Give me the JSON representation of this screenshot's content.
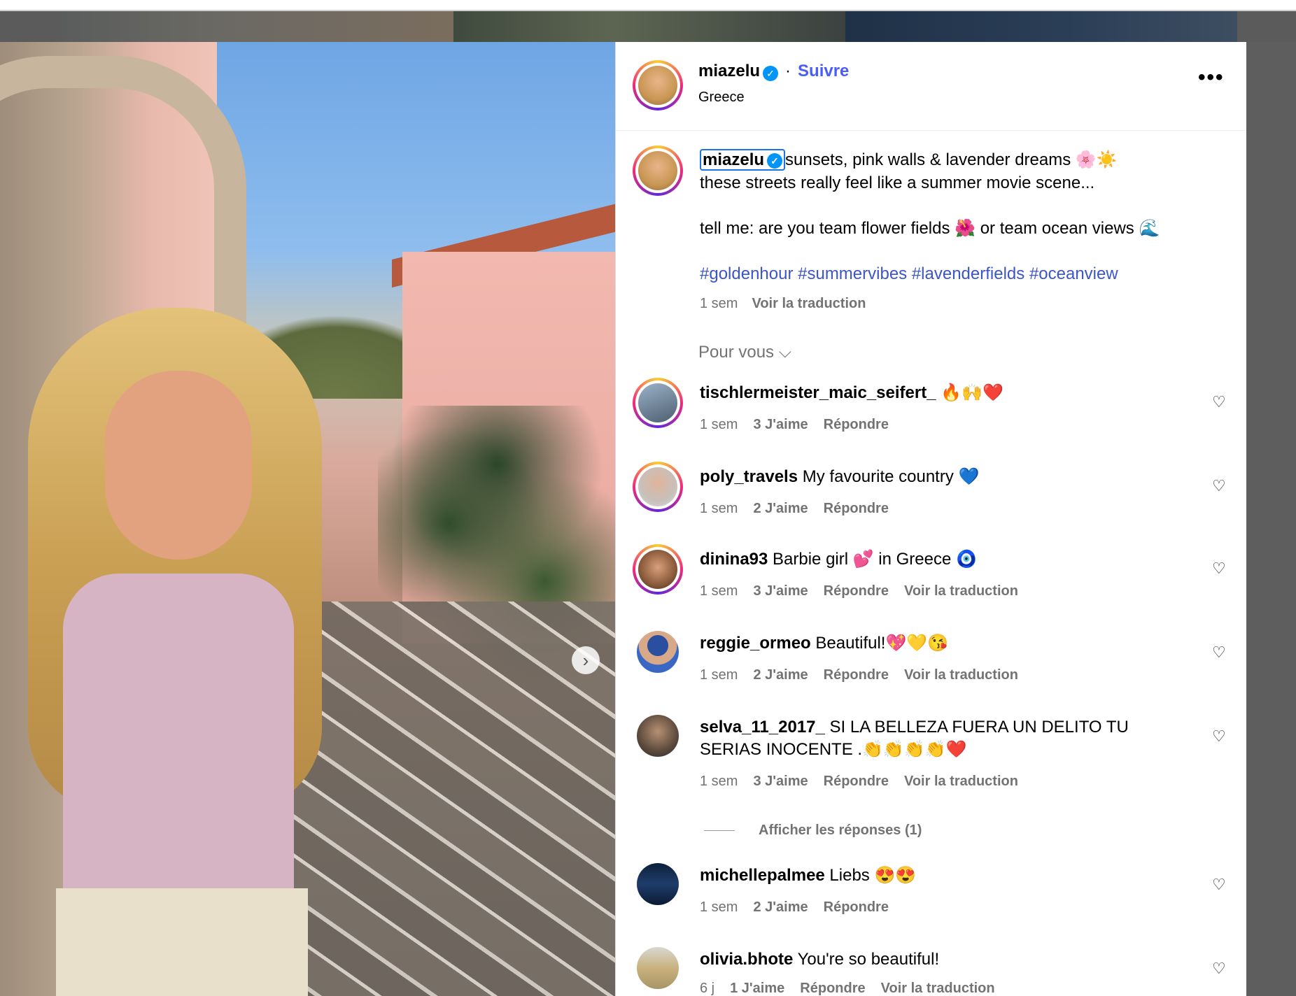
{
  "post": {
    "author": "miazelu",
    "follow_label": "Suivre",
    "location": "Greece",
    "more_label": "•••",
    "caption_user": "miazelu",
    "caption_line1": "sunsets, pink walls & lavender dreams 🌸☀️",
    "caption_line2": "these streets really feel like a summer movie scene...",
    "caption_line3": "tell me: are you team flower fields 🌺 or team ocean views 🌊",
    "hashtags": "#goldenhour #summervibes #lavenderfields #oceanview",
    "time": "1 sem",
    "translate_label": "Voir la traduction",
    "sort_label": "Pour vous ⌵"
  },
  "media": {
    "next_icon": "›"
  },
  "comments": [
    {
      "user": "tischlermeister_maic_seifert_",
      "text": " 🔥🙌❤️",
      "time": "1 sem",
      "likes": "3 J'aime",
      "reply": "Répondre",
      "translate": ""
    },
    {
      "user": "poly_travels",
      "text": " My favourite country 💙",
      "time": "1 sem",
      "likes": "2 J'aime",
      "reply": "Répondre",
      "translate": ""
    },
    {
      "user": "dinina93",
      "text": " Barbie girl 💕 in Greece 🧿",
      "time": "1 sem",
      "likes": "3 J'aime",
      "reply": "Répondre",
      "translate": "Voir la traduction"
    },
    {
      "user": "reggie_ormeo",
      "text": " Beautiful!💖💛😘",
      "time": "1 sem",
      "likes": "2 J'aime",
      "reply": "Répondre",
      "translate": "Voir la traduction"
    },
    {
      "user": "selva_11_2017_",
      "text": " SI LA BELLEZA FUERA UN DELITO TU SERIAS INOCENTE .👏👏👏👏❤️",
      "time": "1 sem",
      "likes": "3 J'aime",
      "reply": "Répondre",
      "translate": "Voir la traduction"
    },
    {
      "user": "michellepalmee",
      "text": " Liebs 😍😍",
      "time": "1 sem",
      "likes": "2 J'aime",
      "reply": "Répondre",
      "translate": ""
    },
    {
      "user": "olivia.bhote",
      "text": " You're so beautiful!",
      "time": "6 j",
      "likes": "1 J'aime",
      "reply": "Répondre",
      "translate": "Voir la traduction"
    }
  ],
  "view_replies": "Afficher les réponses (1)",
  "colors": {
    "follow": "#4a5df9",
    "verified": "#0095f6",
    "hashtag": "#3c55c8",
    "meta": "#737373"
  }
}
